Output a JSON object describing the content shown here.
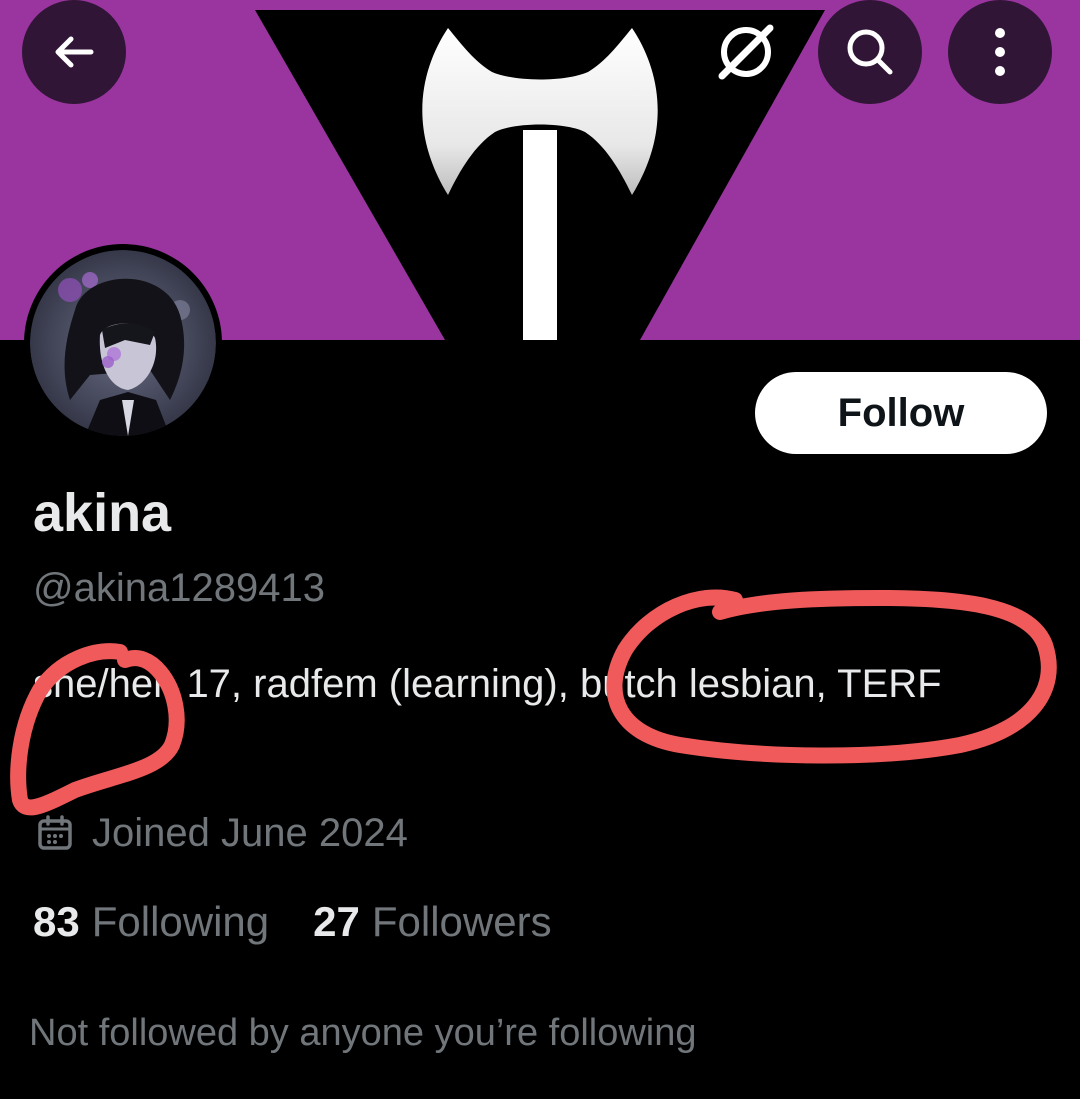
{
  "colors": {
    "banner_purple": "#9a35a0",
    "background": "#000000",
    "follow_bg": "#ffffff",
    "text_primary": "#e7e9ea",
    "text_secondary": "#71767b",
    "annotation_red": "#f05a5a"
  },
  "header": {
    "back_icon": "arrow-left-icon",
    "grok_icon": "grok-icon",
    "search_icon": "search-icon",
    "more_icon": "more-vertical-icon",
    "banner_graphic": "labrys-flag"
  },
  "profile": {
    "display_name": "akina",
    "handle": "@akina1289413",
    "bio": "she/her, 17, radfem (learning), butch lesbian, TERF",
    "joined": "Joined June 2024",
    "following_count": "83",
    "following_label": "Following",
    "followers_count": "27",
    "followers_label": "Followers",
    "follow_button": "Follow",
    "not_followed_text": "Not followed by anyone you’re following"
  }
}
